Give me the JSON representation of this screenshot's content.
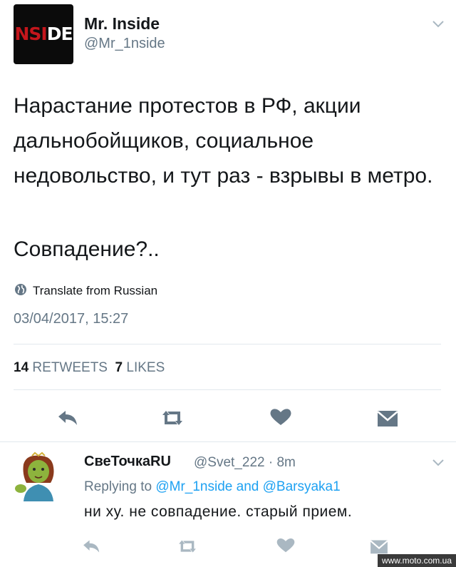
{
  "author": {
    "avatar_text_a": "NSI",
    "avatar_text_b": "DE",
    "name": "Mr. Inside",
    "handle": "@Mr_1nside"
  },
  "tweet": {
    "text": "Нарастание протестов в РФ, акции дальнобойщиков, социальное недовольство, и тут раз - взрывы в метро.",
    "text2": "Совпадение?..",
    "translate_label": "Translate from Russian",
    "timestamp": "03/04/2017, 15:27"
  },
  "stats": {
    "retweets_count": "14",
    "retweets_label": "RETWEETS",
    "likes_count": "7",
    "likes_label": "LIKES"
  },
  "actions": [
    "reply-icon",
    "retweet-icon",
    "like-icon",
    "message-icon"
  ],
  "reply": {
    "name": "СвеТочкаRU",
    "handle": "@Svet_222",
    "separator": "·",
    "time": "8m",
    "replying_prefix": "Replying to",
    "replying_user1": "@Mr_1nside",
    "replying_and": "and",
    "replying_user2": "@Barsyaka1",
    "text": "ни ху. не совпадение. старый прием."
  },
  "watermark": "www.moto.com.ua",
  "colors": {
    "text": "#14171a",
    "secondary": "#657786",
    "link": "#1da1f2",
    "icon": "#657786",
    "icon_light": "#aab8c2"
  }
}
